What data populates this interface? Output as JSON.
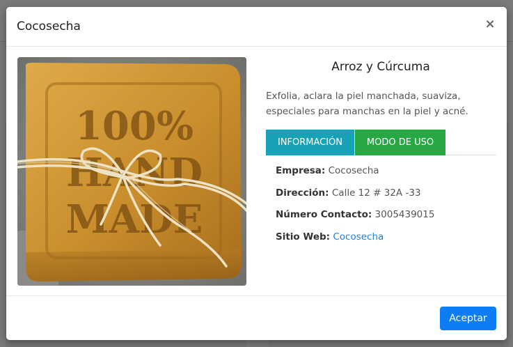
{
  "modal": {
    "title": "Cocosecha",
    "close_icon": "close-icon",
    "close_symbol": "×"
  },
  "product": {
    "image_alt": "soap-bar-photo",
    "image_text_line1": "100%",
    "image_text_line2": "HAND",
    "image_text_line3": "MADE",
    "name": "Arroz y Cúrcuma",
    "description": "Exfolia, aclara la piel manchada, suaviza, especiales para manchas en la piel y acné."
  },
  "tabs": [
    {
      "label": "INFORMACIÓN",
      "color": "#17a2b8"
    },
    {
      "label": "MODO DE USO",
      "color": "#28a745"
    }
  ],
  "info": {
    "empresa_label": "Empresa:",
    "empresa_value": "Cocosecha",
    "direccion_label": "Dirección:",
    "direccion_value": "Calle 12 # 32A -33",
    "contacto_label": "Número Contacto:",
    "contacto_value": "3005439015",
    "web_label": "Sitio Web:",
    "web_value": "Cocosecha"
  },
  "footer": {
    "accept_label": "Aceptar"
  },
  "colors": {
    "primary": "#0d7df5",
    "info": "#17a2b8",
    "success": "#28a745",
    "link": "#1e7fd6"
  }
}
